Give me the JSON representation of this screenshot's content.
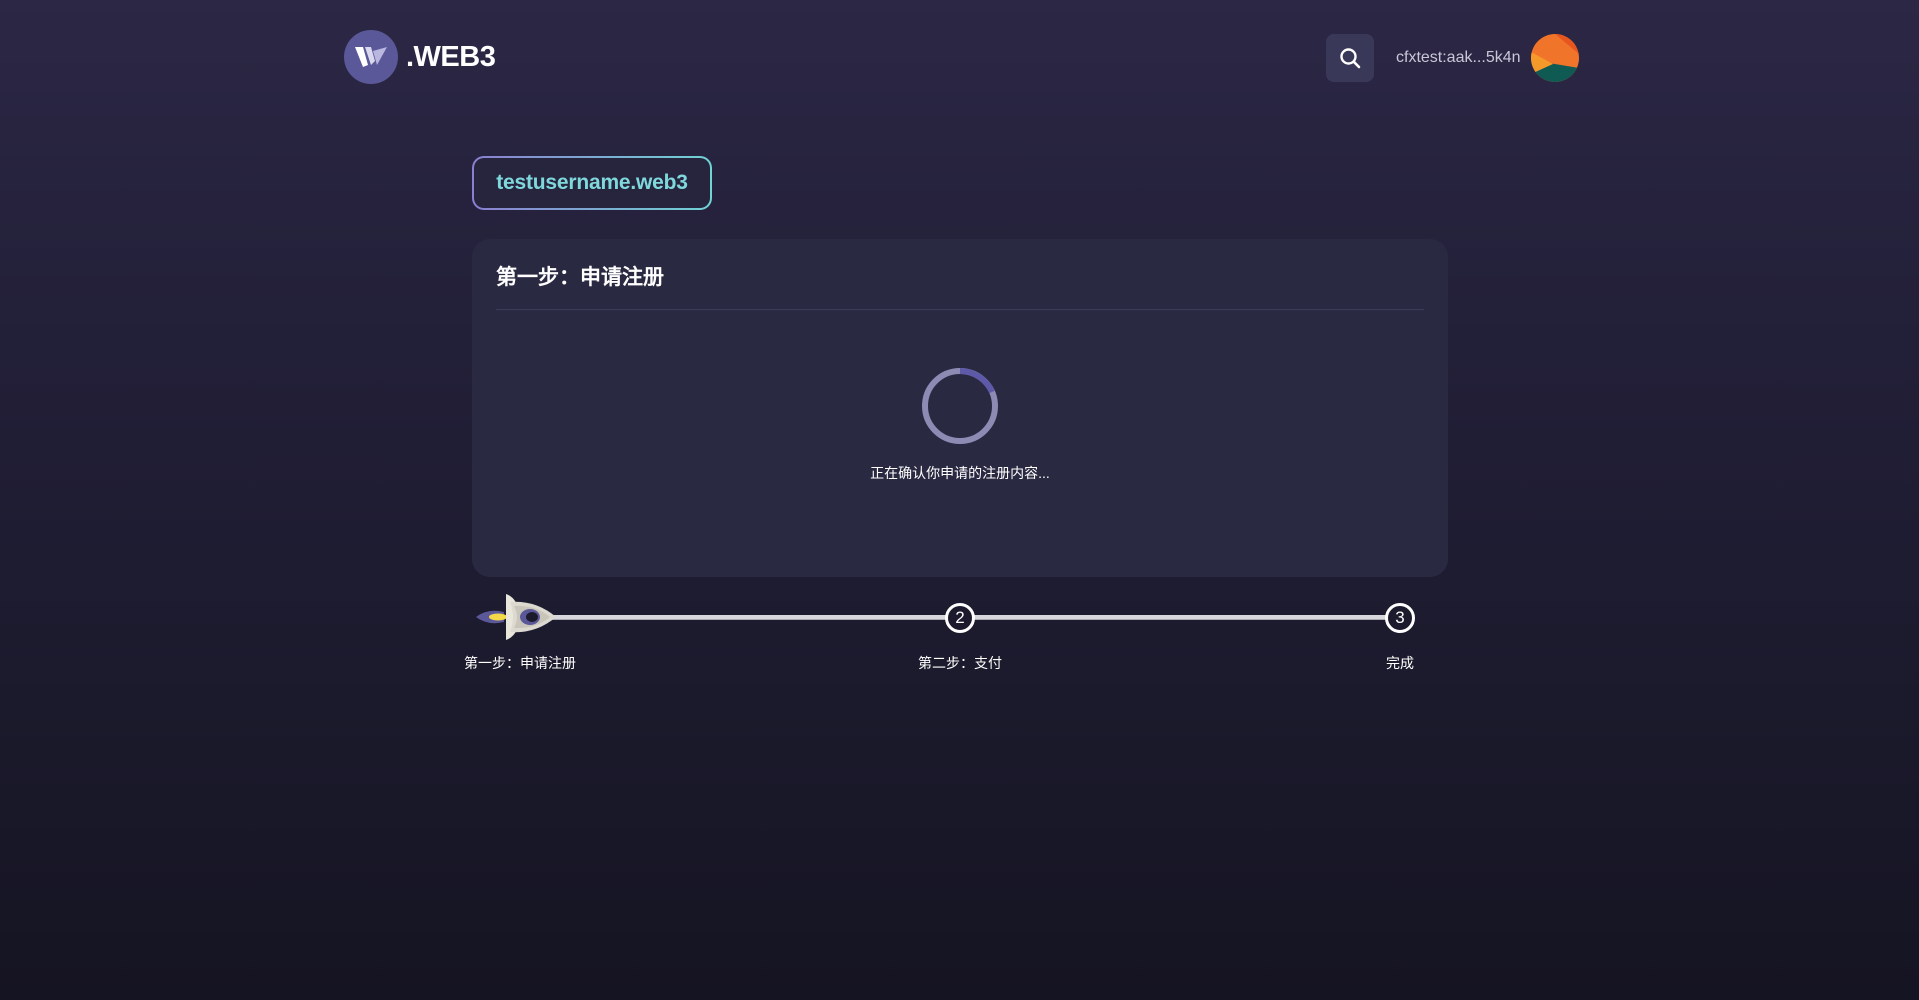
{
  "header": {
    "logo_text": ".WEB3",
    "account_address": "cfxtest:aak...5k4n"
  },
  "domain": {
    "name": "testusername.web3"
  },
  "card": {
    "title": "第一步：申请注册",
    "status": "正在确认你申请的注册内容..."
  },
  "steps": [
    {
      "label": "第一步：申请注册",
      "number": "1",
      "state": "active"
    },
    {
      "label": "第二步：支付",
      "number": "2",
      "state": "pending"
    },
    {
      "label": "完成",
      "number": "3",
      "state": "pending"
    }
  ],
  "colors": {
    "accent_teal": "#7fd8dc",
    "accent_purple": "#5a5898",
    "card_bg": "#2a2942",
    "avatar_orange": "#f0752a",
    "avatar_teal": "#0f5a52"
  },
  "icons": {
    "search": "search-icon",
    "logo": "w-logo-icon",
    "rocket": "rocket-icon"
  }
}
